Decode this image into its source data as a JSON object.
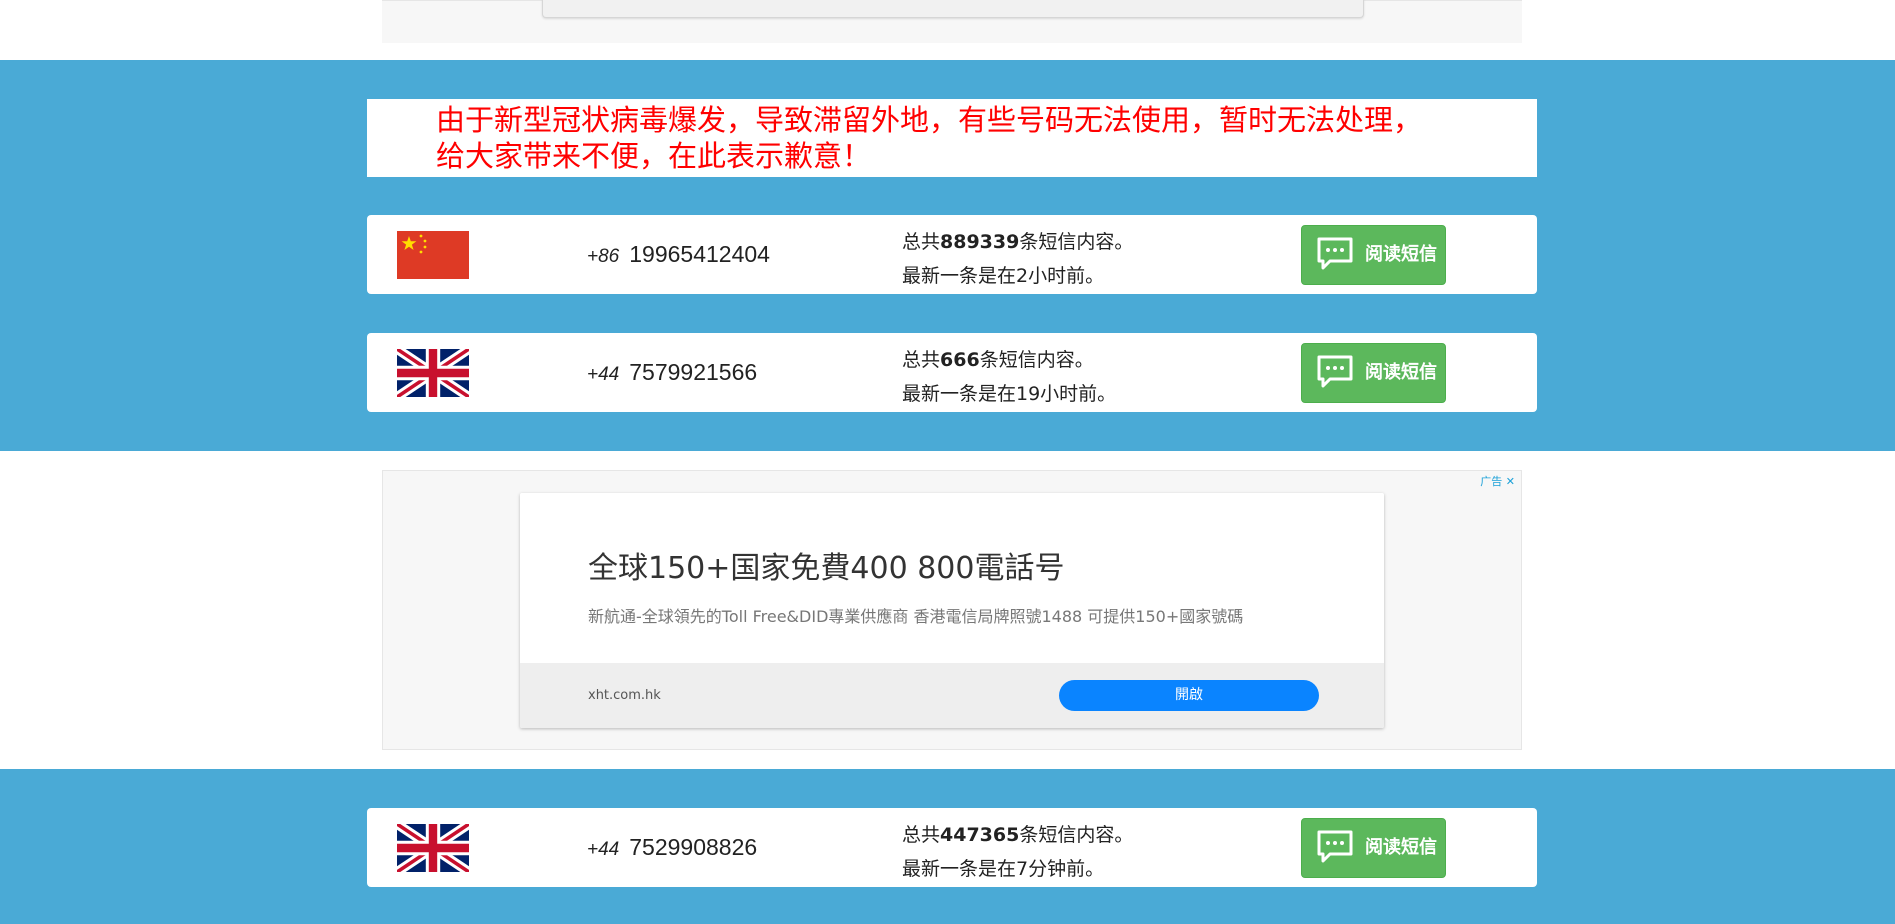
{
  "notice": {
    "line1": "由于新型冠状病毒爆发，导致滞留外地，有些号码无法使用，暂时无法处理，",
    "line2": "给大家带来不便，在此表示歉意！"
  },
  "numbers": [
    {
      "flag": "china-flag",
      "country_code": "+86",
      "phone": "19965412404",
      "total_prefix": "总共",
      "total": "889339",
      "total_suffix": "条短信内容。",
      "latest": "最新一条是在2小时前。",
      "button": "阅读短信"
    },
    {
      "flag": "uk-flag",
      "country_code": "+44",
      "phone": "7579921566",
      "total_prefix": "总共",
      "total": "666",
      "total_suffix": "条短信内容。",
      "latest": "最新一条是在19小时前。",
      "button": "阅读短信"
    },
    {
      "flag": "uk-flag",
      "country_code": "+44",
      "phone": "7529908826",
      "total_prefix": "总共",
      "total": "447365",
      "total_suffix": "条短信内容。",
      "latest": "最新一条是在7分钟前。",
      "button": "阅读短信"
    }
  ],
  "ad": {
    "mark": "广告 ✕",
    "title": "全球150+国家免費400 800電話号",
    "description": "新航通-全球領先的Toll Free&DID專業供應商 香港電信局牌照號1488 可提供150+國家號碼",
    "url": "xht.com.hk",
    "open_label": "開啟"
  },
  "colors": {
    "band": "#4aaad6",
    "notice_text": "#ff0000",
    "button": "#5cb85c",
    "ad_button": "#0a84ff"
  }
}
